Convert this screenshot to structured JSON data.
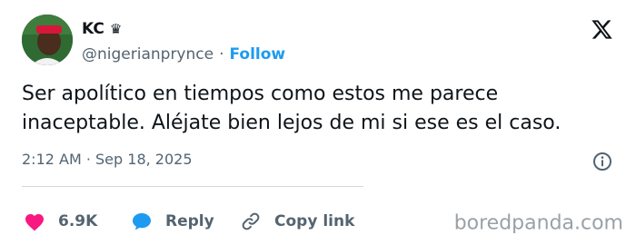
{
  "author": {
    "display_name": "KC",
    "badge": "♛",
    "handle": "@nigerianprynce",
    "separator": "·",
    "follow_label": "Follow"
  },
  "tweet": {
    "text_lines": [
      "Ser apolítico en tiempos como estos me parece",
      "inaceptable. Aléjate bien lejos de mi si ese es el caso."
    ],
    "timestamp": "2:12 AM · Sep 18, 2025"
  },
  "actions": {
    "likes_count": "6.9K",
    "reply_label": "Reply",
    "copy_link_label": "Copy link"
  },
  "watermark": "boredpanda.com",
  "icons": {
    "logo": "x-logo-icon",
    "info": "info-icon",
    "like": "heart-icon",
    "reply": "speech-bubble-icon",
    "copy": "link-icon"
  },
  "colors": {
    "text": "#0f1419",
    "secondary": "#536471",
    "follow": "#1d9bf0",
    "like": "#f91880",
    "reply": "#1d9bf0",
    "watermark": "#9aa1a6"
  }
}
